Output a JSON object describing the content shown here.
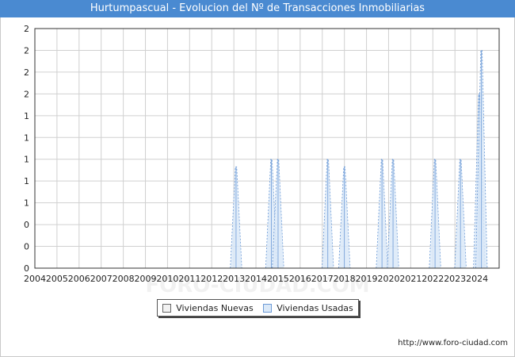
{
  "header": {
    "title": "Hurtumpascual - Evolucion del Nº de Transacciones Inmobiliarias"
  },
  "footer": {
    "url": "http://www.foro-ciudad.com"
  },
  "watermark": "FORO-CIUDAD.COM",
  "colors": {
    "title_bar": "#4a8ad1",
    "nuevas_fill": "#f2f2f2",
    "usadas_fill": "#dbe9f8",
    "usadas_line": "#6c9ad6",
    "grid": "#d0d0d0"
  },
  "chart_data": {
    "type": "area",
    "title": "Hurtumpascual - Evolucion del Nº de Transacciones Inmobiliarias",
    "xlabel": "",
    "ylabel": "",
    "xlim": [
      2004,
      2025
    ],
    "ylim": [
      0,
      2.2
    ],
    "x_ticks": [
      "2004",
      "2005",
      "2006",
      "2007",
      "2008",
      "2009",
      "2010",
      "2011",
      "2012",
      "2013",
      "2014",
      "2015",
      "2016",
      "2017",
      "2018",
      "2019",
      "2020",
      "2021",
      "2022",
      "2023",
      "2024"
    ],
    "y_ticks": [
      {
        "value": 0,
        "label": "0"
      },
      {
        "value": 0.2,
        "label": "0"
      },
      {
        "value": 0.4,
        "label": "0"
      },
      {
        "value": 0.6,
        "label": "1"
      },
      {
        "value": 0.8,
        "label": "1"
      },
      {
        "value": 1.0,
        "label": "1"
      },
      {
        "value": 1.2,
        "label": "1"
      },
      {
        "value": 1.4,
        "label": "1"
      },
      {
        "value": 1.6,
        "label": "2"
      },
      {
        "value": 1.8,
        "label": "2"
      },
      {
        "value": 2.0,
        "label": "2"
      },
      {
        "value": 2.2,
        "label": "2"
      }
    ],
    "grid": true,
    "legend_position": "bottom-center",
    "series": [
      {
        "name": "Viviendas Nuevas",
        "peaks": []
      },
      {
        "name": "Viviendas Usadas",
        "peaks": [
          {
            "x": 2013.1,
            "y": 0.93
          },
          {
            "x": 2014.7,
            "y": 1.0
          },
          {
            "x": 2015.0,
            "y": 1.0
          },
          {
            "x": 2017.25,
            "y": 1.0
          },
          {
            "x": 2018.0,
            "y": 0.93
          },
          {
            "x": 2019.7,
            "y": 1.0
          },
          {
            "x": 2020.2,
            "y": 1.0
          },
          {
            "x": 2022.1,
            "y": 1.0
          },
          {
            "x": 2023.25,
            "y": 1.0
          },
          {
            "x": 2024.1,
            "y": 1.6
          },
          {
            "x": 2024.2,
            "y": 2.0
          }
        ]
      }
    ]
  }
}
